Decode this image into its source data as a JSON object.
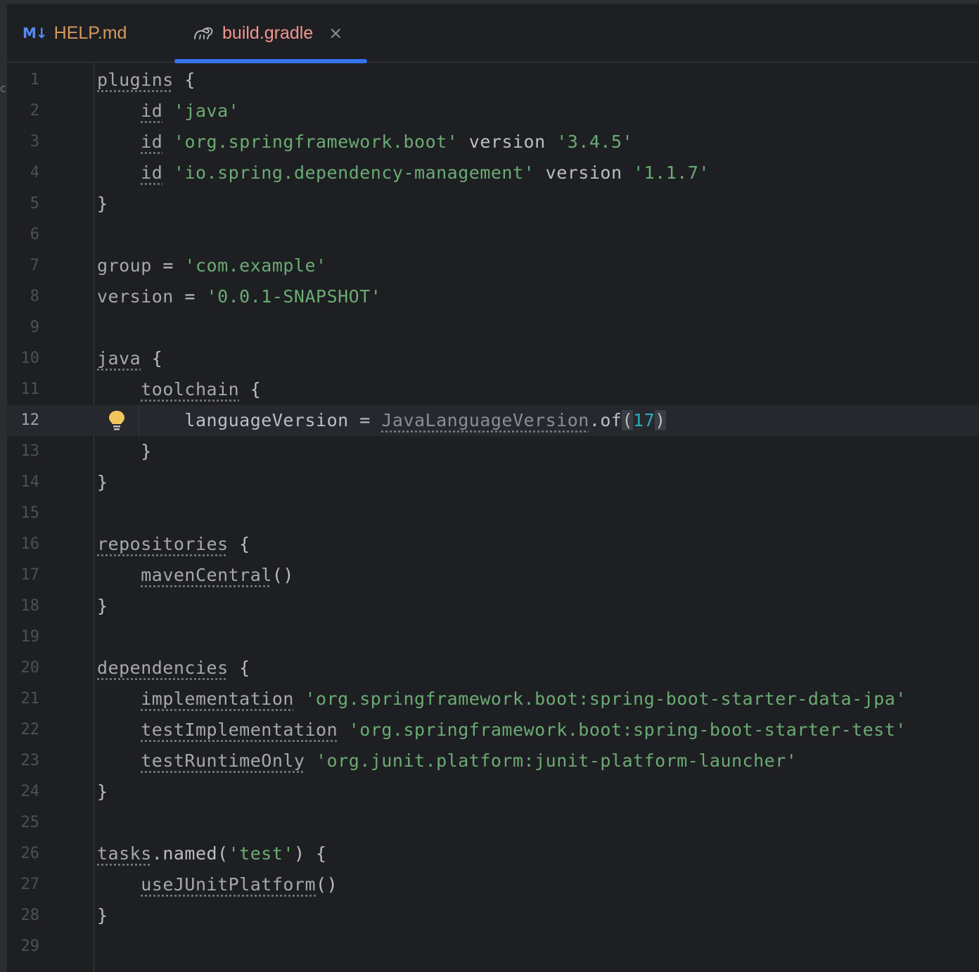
{
  "tabs": [
    {
      "icon": "markdown-icon",
      "icon_text": "M↓",
      "label": "HELP.md",
      "active": false
    },
    {
      "icon": "gradle-icon",
      "label": "build.gradle",
      "active": true,
      "close_glyph": "×"
    }
  ],
  "editor": {
    "current_line": 12,
    "lines": [
      {
        "n": "1",
        "tokens": [
          [
            "kwu",
            "plugins"
          ],
          [
            "kw",
            " {"
          ]
        ]
      },
      {
        "n": "2",
        "tokens": [
          [
            "kw",
            "    "
          ],
          [
            "kwu",
            "id"
          ],
          [
            "kw",
            " "
          ],
          [
            "str",
            "'java'"
          ]
        ]
      },
      {
        "n": "3",
        "tokens": [
          [
            "kw",
            "    "
          ],
          [
            "kwu",
            "id"
          ],
          [
            "kw",
            " "
          ],
          [
            "str",
            "'org.springframework.boot'"
          ],
          [
            "kw",
            " version "
          ],
          [
            "str",
            "'3.4.5'"
          ]
        ]
      },
      {
        "n": "4",
        "tokens": [
          [
            "kw",
            "    "
          ],
          [
            "kwu",
            "id"
          ],
          [
            "kw",
            " "
          ],
          [
            "str",
            "'io.spring.dependency-management'"
          ],
          [
            "kw",
            " version "
          ],
          [
            "str",
            "'1.1.7'"
          ]
        ]
      },
      {
        "n": "5",
        "tokens": [
          [
            "kw",
            "}"
          ]
        ]
      },
      {
        "n": "6",
        "tokens": []
      },
      {
        "n": "7",
        "tokens": [
          [
            "dim",
            "group"
          ],
          [
            "kw",
            " = "
          ],
          [
            "str",
            "'com.example'"
          ]
        ]
      },
      {
        "n": "8",
        "tokens": [
          [
            "dim",
            "version"
          ],
          [
            "kw",
            " = "
          ],
          [
            "str",
            "'0.0.1-SNAPSHOT'"
          ]
        ]
      },
      {
        "n": "9",
        "tokens": []
      },
      {
        "n": "10",
        "tokens": [
          [
            "kwu",
            "java"
          ],
          [
            "kw",
            " {"
          ]
        ]
      },
      {
        "n": "11",
        "tokens": [
          [
            "kw",
            "    "
          ],
          [
            "kwu",
            "toolchain"
          ],
          [
            "kw",
            " {"
          ]
        ]
      },
      {
        "n": "12",
        "tokens": [
          [
            "kw",
            "        languageVersion = "
          ],
          [
            "cls",
            "JavaLanguageVersion"
          ],
          [
            "kw",
            ".of"
          ],
          [
            "phl",
            "("
          ],
          [
            "num",
            "17"
          ],
          [
            "phl",
            ")"
          ]
        ]
      },
      {
        "n": "13",
        "tokens": [
          [
            "kw",
            "    }"
          ]
        ]
      },
      {
        "n": "14",
        "tokens": [
          [
            "kw",
            "}"
          ]
        ]
      },
      {
        "n": "15",
        "tokens": []
      },
      {
        "n": "16",
        "tokens": [
          [
            "kwu",
            "repositories"
          ],
          [
            "kw",
            " {"
          ]
        ]
      },
      {
        "n": "17",
        "tokens": [
          [
            "kw",
            "    "
          ],
          [
            "kwu",
            "mavenCentral"
          ],
          [
            "kw",
            "()"
          ]
        ]
      },
      {
        "n": "18",
        "tokens": [
          [
            "kw",
            "}"
          ]
        ]
      },
      {
        "n": "19",
        "tokens": []
      },
      {
        "n": "20",
        "tokens": [
          [
            "kwu",
            "dependencies"
          ],
          [
            "kw",
            " {"
          ]
        ]
      },
      {
        "n": "21",
        "tokens": [
          [
            "kw",
            "    "
          ],
          [
            "kwu",
            "implementation"
          ],
          [
            "kw",
            " "
          ],
          [
            "str",
            "'org.springframework.boot:spring-boot-starter-data-jpa'"
          ]
        ]
      },
      {
        "n": "22",
        "tokens": [
          [
            "kw",
            "    "
          ],
          [
            "kwu",
            "testImplementation"
          ],
          [
            "kw",
            " "
          ],
          [
            "str",
            "'org.springframework.boot:spring-boot-starter-test'"
          ]
        ]
      },
      {
        "n": "23",
        "tokens": [
          [
            "kw",
            "    "
          ],
          [
            "kwu",
            "testRuntimeOnly"
          ],
          [
            "kw",
            " "
          ],
          [
            "str",
            "'org.junit.platform:junit-platform-launcher'"
          ]
        ]
      },
      {
        "n": "24",
        "tokens": [
          [
            "kw",
            "}"
          ]
        ]
      },
      {
        "n": "25",
        "tokens": []
      },
      {
        "n": "26",
        "tokens": [
          [
            "kwu",
            "tasks"
          ],
          [
            "kw",
            ".named("
          ],
          [
            "str",
            "'test'"
          ],
          [
            "kw",
            ") {"
          ]
        ]
      },
      {
        "n": "27",
        "tokens": [
          [
            "kw",
            "    "
          ],
          [
            "kwu",
            "useJUnitPlatform"
          ],
          [
            "kw",
            "()"
          ]
        ]
      },
      {
        "n": "28",
        "tokens": [
          [
            "kw",
            "}"
          ]
        ]
      },
      {
        "n": "29",
        "tokens": []
      }
    ]
  },
  "colors": {
    "background": "#1e1f22",
    "string": "#6aab73",
    "number": "#2aacb8",
    "accent": "#3574f0",
    "bulb": "#f2c55c"
  }
}
